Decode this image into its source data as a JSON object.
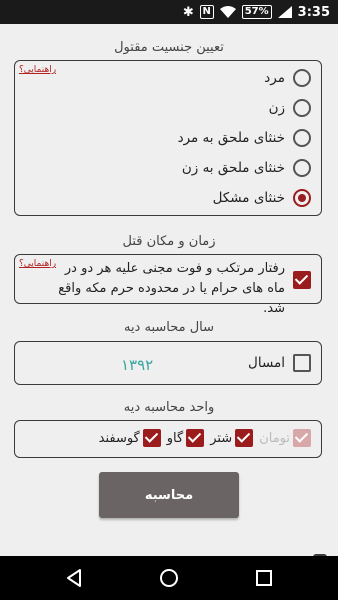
{
  "status_bar": {
    "battery": "57%",
    "time": "3:35"
  },
  "gender_section": {
    "title": "تعیین جنسیت مقتول",
    "help": "راهنمایی؟",
    "options": [
      {
        "label": "مرد",
        "selected": false
      },
      {
        "label": "زن",
        "selected": false
      },
      {
        "label": "خنثای ملحق به مرد",
        "selected": false
      },
      {
        "label": "خنثای ملحق به زن",
        "selected": false
      },
      {
        "label": "خنثای مشکل",
        "selected": true
      }
    ]
  },
  "time_place_section": {
    "title": "زمان و مکان قتل",
    "help": "راهنمایی؟",
    "checked": true,
    "text": "رفتار مرتکب و فوت مجنی علیه هر دو در ماه های حرام یا در محدوده حرم مکه واقع شد."
  },
  "year_section": {
    "title": "سال محاسبه دیه",
    "year_value": "۱۳۹۲",
    "current_year_label": "امسال",
    "current_year_checked": false
  },
  "unit_section": {
    "title": "واحد محاسبه دیه",
    "units": [
      {
        "label": "تومان",
        "state": "disabled"
      },
      {
        "label": "شتر",
        "state": "checked"
      },
      {
        "label": "گاو",
        "state": "checked"
      },
      {
        "label": "گوسفند",
        "state": "checked"
      }
    ]
  },
  "calculate_button": "محاسبه",
  "colors": {
    "accent": "#9b1c1c",
    "button": "#6b6464",
    "year_value": "#3aa6a0"
  }
}
